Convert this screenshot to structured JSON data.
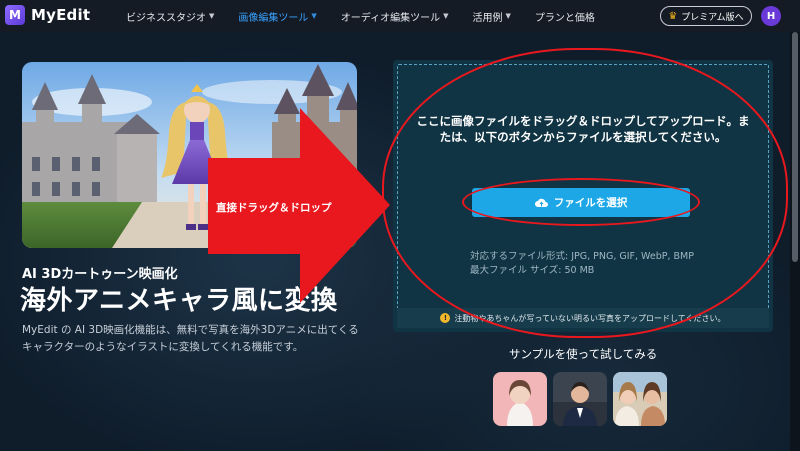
{
  "nav": {
    "logo_mark": "M",
    "logo_text": "MyEdit",
    "items": [
      {
        "label": "ビジネススタジオ",
        "has_chevron": true,
        "active": false
      },
      {
        "label": "画像編集ツール",
        "has_chevron": true,
        "active": true
      },
      {
        "label": "オーディオ編集ツール",
        "has_chevron": true,
        "active": false
      },
      {
        "label": "活用例",
        "has_chevron": true,
        "active": false
      },
      {
        "label": "プランと価格",
        "has_chevron": false,
        "active": false
      }
    ],
    "premium_label": "プレミアム版へ",
    "avatar_initial": "H"
  },
  "hero": {
    "subtitle": "AI 3Dカートゥーン映画化",
    "title": "海外アニメキャラ風に変換",
    "description": "MyEdit の AI 3D映画化機能は、無料で写真を海外3Dアニメに出てくるキャラクターのようなイラストに変換してくれる機能です。"
  },
  "annotation": {
    "arrow_label": "直接ドラッグ＆ドロップ",
    "color": "#e8181e"
  },
  "upload": {
    "instruction": "ここに画像ファイルをドラッグ＆ドロップしてアップロード。または、以下のボタンからファイルを選択してください。",
    "button_label": "ファイルを選択",
    "formats": "対応するファイル形式: JPG, PNG, GIF, WebP, BMP",
    "max_size": "最大ファイル サイズ: 50 MB",
    "notice": "注動物やあちゃんが写っていない明るい写真をアップロードしてください。"
  },
  "samples": {
    "title": "サンプルを使って試してみる"
  },
  "colors": {
    "accent_blue": "#1da7e6",
    "nav_active": "#3aa2ff",
    "brand_purple": "#6a3ad8"
  }
}
